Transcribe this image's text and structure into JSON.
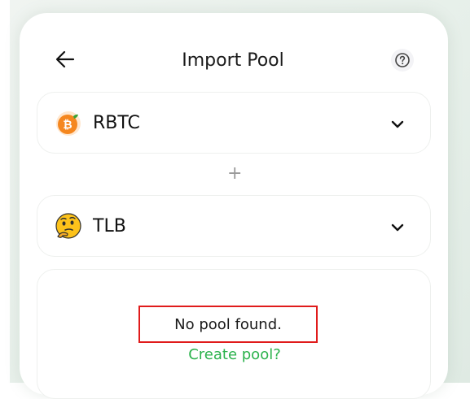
{
  "header": {
    "title": "Import Pool",
    "back_icon": "arrow-left-icon",
    "help_icon": "question-circle-icon"
  },
  "tokens": [
    {
      "symbol": "RBTC",
      "icon": "rbtc-token-icon",
      "chevron_icon": "chevron-down-icon"
    },
    {
      "symbol": "TLB",
      "icon": "thinking-face-icon",
      "chevron_icon": "chevron-down-icon"
    }
  ],
  "separator": "+",
  "result": {
    "message": "No pool found.",
    "action_label": "Create pool?"
  },
  "colors": {
    "accent": "#2bb24c",
    "highlight_border": "#e01b1b",
    "rbtc_orange": "#f5871f",
    "thinking_yellow": "#fcc21b"
  }
}
